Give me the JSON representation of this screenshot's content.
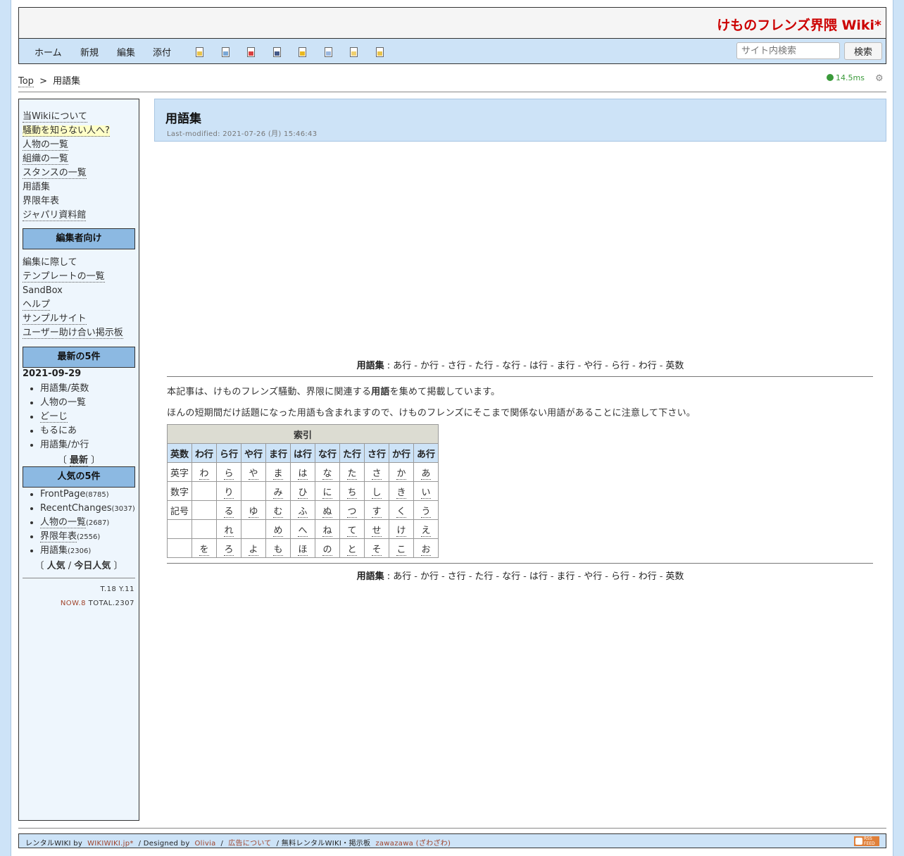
{
  "site": {
    "title": "けものフレンズ界隈 Wiki*"
  },
  "toolbar": {
    "menu": [
      "ホーム",
      "新規",
      "編集",
      "添付"
    ],
    "icons": [
      "page-icon",
      "copy-icon",
      "delete-icon",
      "save-icon",
      "lock-icon",
      "pages-icon",
      "list-icon",
      "help-icon"
    ],
    "search_placeholder": "サイト内検索",
    "search_button": "検索"
  },
  "breadcrumb": {
    "top": "Top",
    "sep": ">",
    "current": "用語集"
  },
  "timing": "14.5ms",
  "sidebar": {
    "links": [
      "当Wikiについて",
      "騒動を知らない人へ?",
      "人物の一覧",
      "組織の一覧",
      "スタンスの一覧",
      "用語集",
      "界限年表",
      "ジャパリ資料館"
    ],
    "editors_head": "編集者向け",
    "editor_links": [
      "編集に際して",
      "テンプレートの一覧",
      "SandBox",
      "ヘルプ",
      "サンプルサイト",
      "ユーザー助け合い掲示板"
    ],
    "recent_head": "最新の5件",
    "recent_date": "2021-09-29",
    "recent": [
      "用語集/英数",
      "人物の一覧",
      "どーじ",
      "もるにあ",
      "用語集/か行"
    ],
    "recent_more": "最新",
    "popular_head": "人気の5件",
    "popular": [
      {
        "name": "FrontPage",
        "count": "(8785)"
      },
      {
        "name": "RecentChanges",
        "count": "(3037)"
      },
      {
        "name": "人物の一覧",
        "count": "(2687)"
      },
      {
        "name": "界限年表",
        "count": "(2556)"
      },
      {
        "name": "用語集",
        "count": "(2306)"
      }
    ],
    "popular_more_a": "人気",
    "popular_more_b": "今日人気",
    "counter_ty": "T.18 Y.11",
    "counter_now": "NOW.8",
    "counter_total": "TOTAL.2307"
  },
  "page": {
    "title": "用語集",
    "last_modified": "Last-modified: 2021-07-26 (月) 15:46:43",
    "nav_label": "用語集",
    "nav_items": [
      "あ行",
      "か行",
      "さ行",
      "た行",
      "な行",
      "は行",
      "ま行",
      "や行",
      "ら行",
      "わ行",
      "英数"
    ],
    "intro1_a": "本記事は、けものフレンズ騒動、界限に関連する",
    "intro1_b": "用語",
    "intro1_c": "を集めて掲載しています。",
    "intro2": "ほんの短期間だけ話題になった用語も含まれますので、けものフレンズにそこまで関係ない用語があることに注意して下さい。",
    "index_caption": "索引",
    "index_headers": [
      "英数",
      "わ行",
      "ら行",
      "や行",
      "ま行",
      "は行",
      "な行",
      "た行",
      "さ行",
      "か行",
      "あ行"
    ],
    "index_rows": [
      [
        "英字",
        "わ",
        "ら",
        "や",
        "ま",
        "は",
        "な",
        "た",
        "さ",
        "か",
        "あ"
      ],
      [
        "数字",
        "",
        "り",
        "",
        "み",
        "ひ",
        "に",
        "ち",
        "し",
        "き",
        "い"
      ],
      [
        "記号",
        "",
        "る",
        "ゆ",
        "む",
        "ふ",
        "ぬ",
        "つ",
        "す",
        "く",
        "う"
      ],
      [
        "",
        "",
        "れ",
        "",
        "め",
        "へ",
        "ね",
        "て",
        "せ",
        "け",
        "え"
      ],
      [
        "",
        "を",
        "ろ",
        "よ",
        "も",
        "ほ",
        "の",
        "と",
        "そ",
        "こ",
        "お"
      ]
    ]
  },
  "footer": {
    "t1": "レンタルWIKI by",
    "l1": "WIKIWIKI.jp*",
    "t2": "/ Designed by",
    "l2": "Olivia",
    "t3": "/",
    "l3": "広告について",
    "t4": "/ 無料レンタルWIKI・掲示板",
    "l4": "zawazawa (ざわざわ)",
    "rss1": "RSS",
    "rss2": "FEED"
  },
  "colors": {
    "accent": "#cde3f7",
    "sidebar_head": "#8cb9e2",
    "title_red": "#cc0000"
  }
}
